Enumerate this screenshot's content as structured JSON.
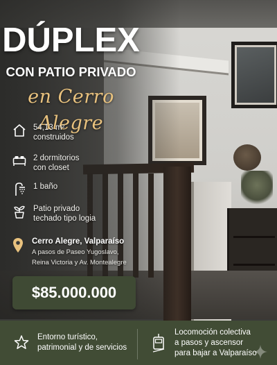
{
  "title": {
    "line1": "DÚPLEX",
    "line2": "CON PATIO PRIVADO",
    "line3": "en Cerro Alegre"
  },
  "features": [
    {
      "icon": "house-icon",
      "lines": [
        "54,13 m²",
        "construidos"
      ]
    },
    {
      "icon": "bed-icon",
      "lines": [
        "2 dormitorios",
        "con closet"
      ]
    },
    {
      "icon": "shower-icon",
      "lines": [
        "1 baño"
      ]
    },
    {
      "icon": "plant-pot-icon",
      "lines": [
        "Patio privado",
        "techado tipo logia"
      ]
    }
  ],
  "location": {
    "icon": "location-pin-icon",
    "name": "Cerro Alegre, Valparaíso",
    "desc_lines": [
      "A pasos de Paseo Yugoslavo,",
      "Reina Victoria y Av. Montealegre"
    ]
  },
  "price": "$85.000.000",
  "bottom": {
    "left": {
      "icon": "star-outline-icon",
      "lines": [
        "Entorno turístico,",
        "patrimonial y de servicios"
      ]
    },
    "right": {
      "icon": "funicular-icon",
      "lines": [
        "Locomoción colectiva",
        "a pasos y ascensor",
        "para bajar a Valparaíso"
      ]
    }
  },
  "colors": {
    "gold_accent": "#e9c27e",
    "olive_band": "#414c35",
    "price_box": "#3f4a34"
  }
}
